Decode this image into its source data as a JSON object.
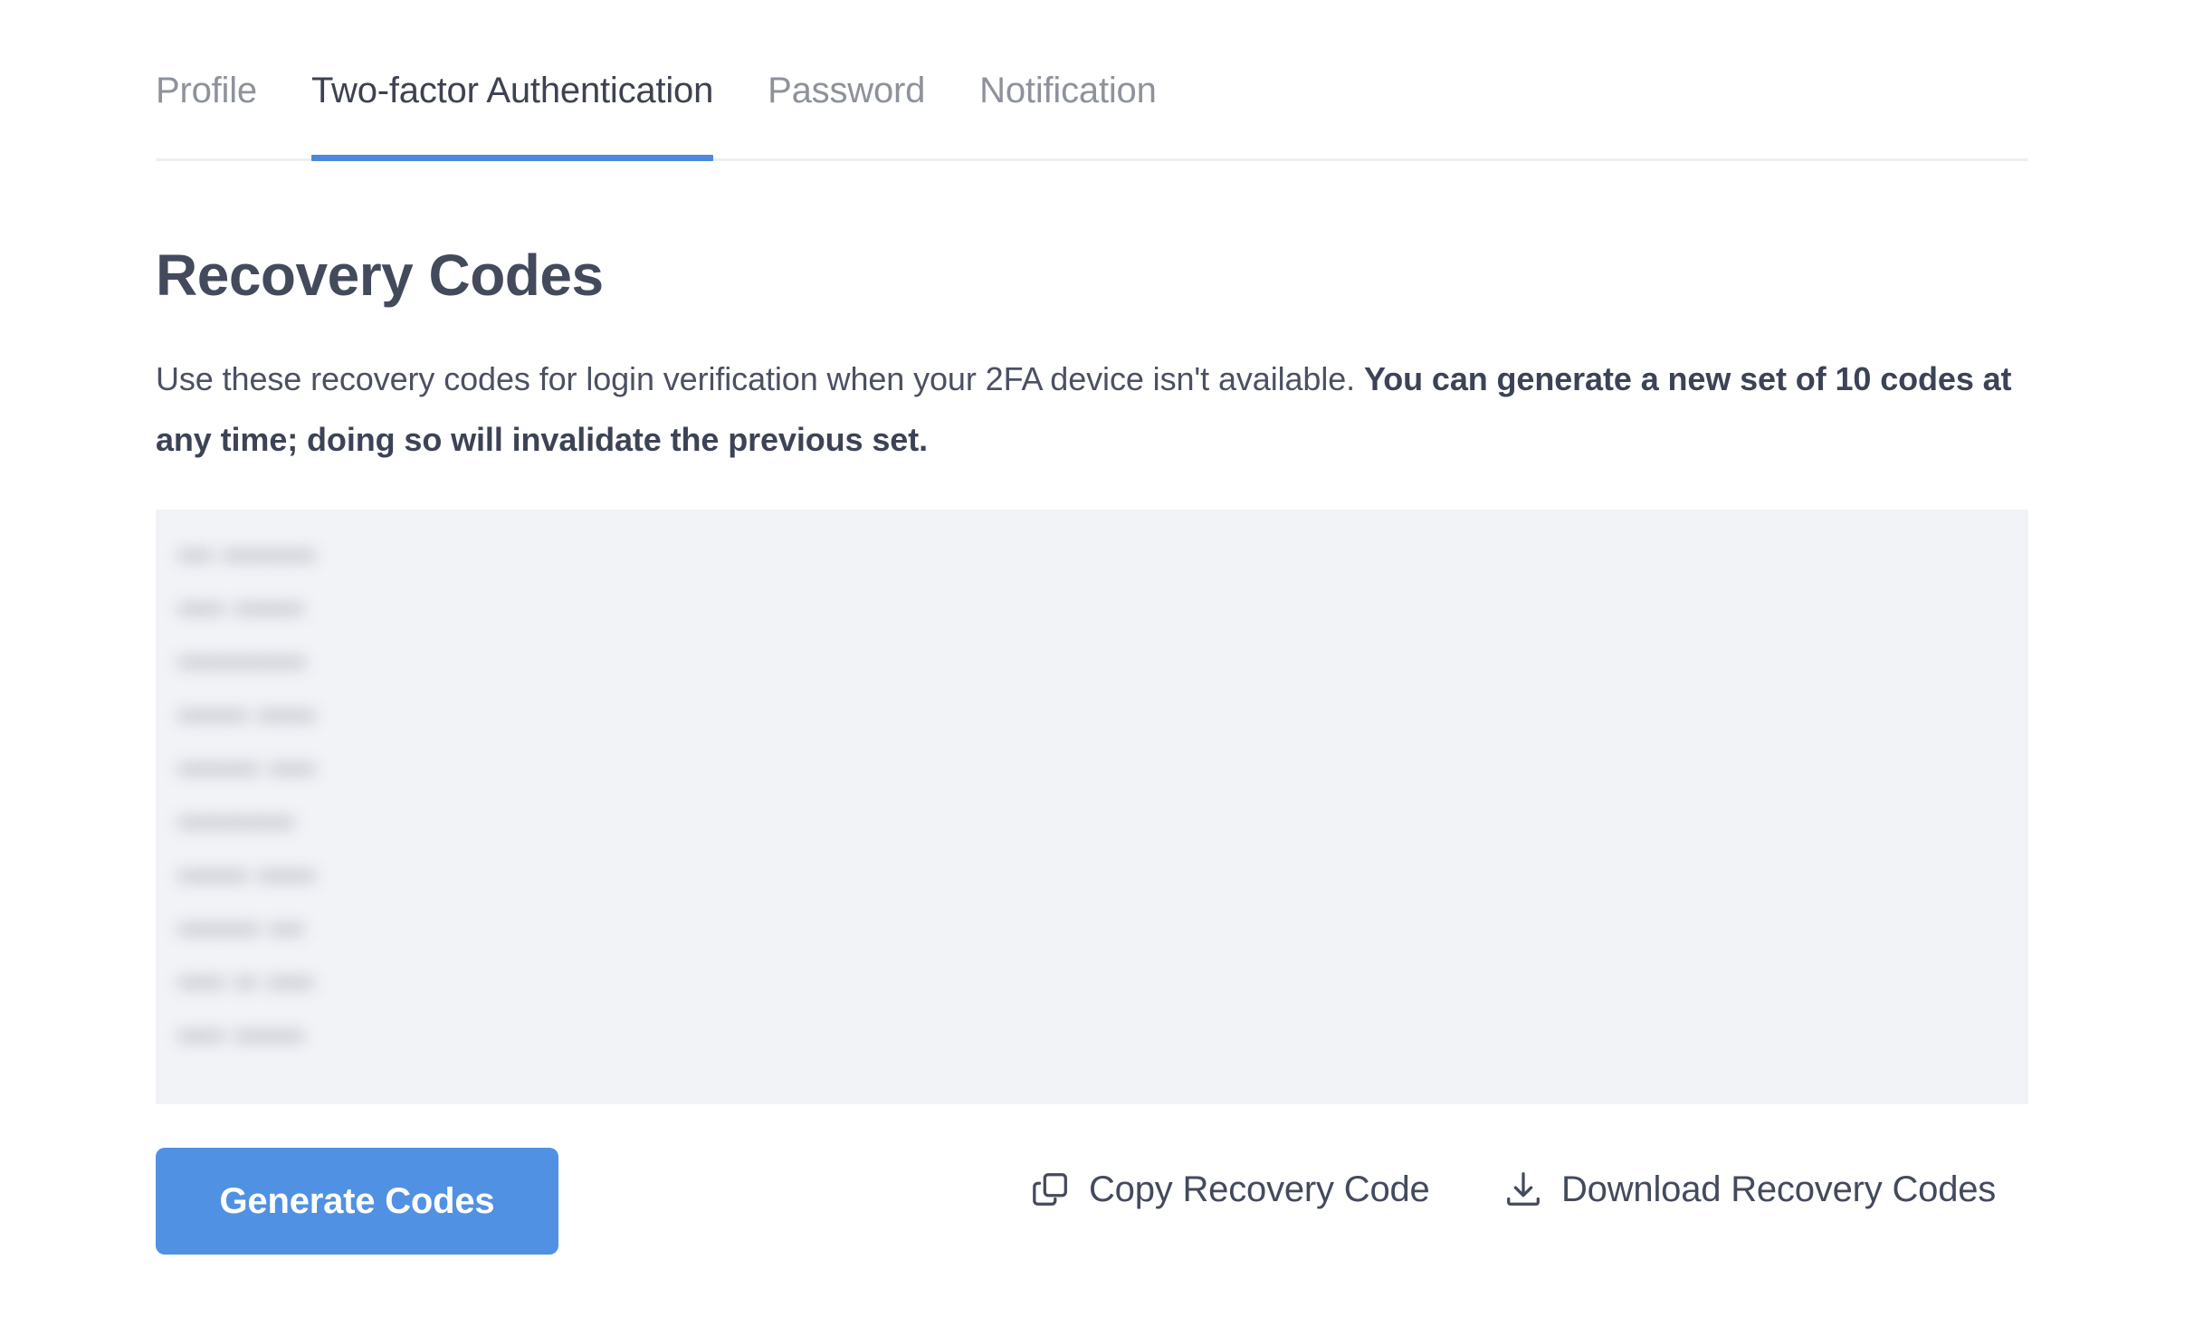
{
  "tabs": [
    {
      "label": "Profile",
      "active": false
    },
    {
      "label": "Two-factor Authentication",
      "active": true
    },
    {
      "label": "Password",
      "active": false
    },
    {
      "label": "Notification",
      "active": false
    }
  ],
  "page": {
    "title": "Recovery Codes",
    "description_plain": "Use these recovery codes for login verification when your 2FA device isn't available. ",
    "description_bold": "You can generate a new set of 10 codes at any time; doing so will invalidate the previous set."
  },
  "recovery_codes": {
    "count": 10,
    "obscured": true,
    "items": [
      "••• ••••••••",
      "•••• ••••••",
      "•••••••••••",
      "•••••• •••••",
      "••••••• ••••",
      "••••••••••",
      "•••••• •••••",
      "••••••• •••",
      "•••• •• ••••",
      "•••• ••••••"
    ]
  },
  "actions": {
    "generate_label": "Generate Codes",
    "copy_label": "Copy Recovery Code",
    "download_label": "Download Recovery Codes"
  },
  "colors": {
    "accent": "#4a89dc",
    "button": "#5091e3",
    "panel_bg": "#f2f3f7",
    "text_dark": "#434a5c",
    "text_muted": "#8d929b",
    "border": "#edeef1"
  }
}
